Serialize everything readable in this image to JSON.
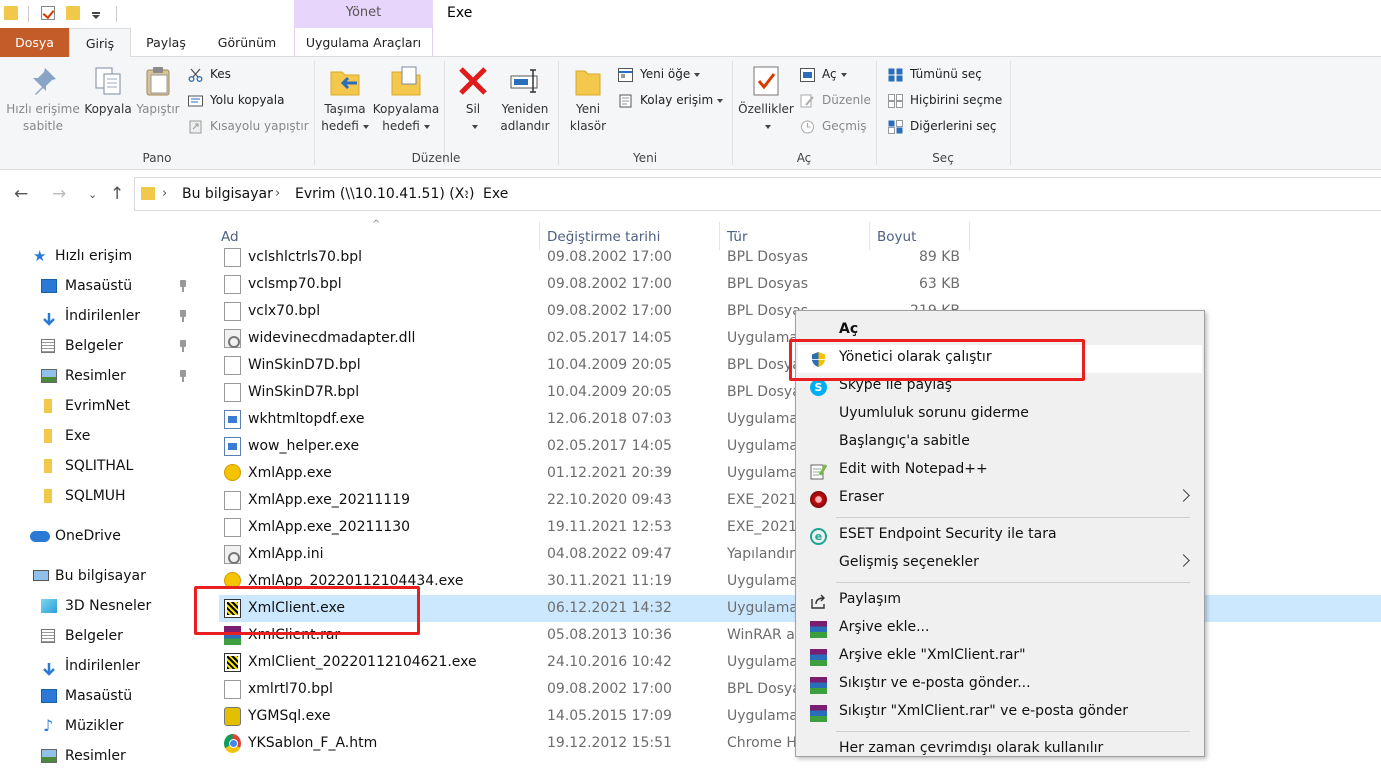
{
  "window": {
    "title": "Exe",
    "contextual_group": "Yönet"
  },
  "ribbon_tabs": [
    "Dosya",
    "Giriş",
    "Paylaş",
    "Görünüm",
    "Uygulama Araçları"
  ],
  "ribbon": {
    "pano": {
      "label": "Pano",
      "pin": [
        "Hızlı erişime",
        "sabitle"
      ],
      "copy": "Kopyala",
      "paste": "Yapıştır",
      "cut": "Kes",
      "copy_path": "Yolu kopyala",
      "paste_shortcut": "Kısayolu yapıştır"
    },
    "duzenle": {
      "label": "Düzenle",
      "move": [
        "Taşıma",
        "hedefi"
      ],
      "copyto": [
        "Kopyalama",
        "hedefi"
      ],
      "delete": "Sil",
      "rename": [
        "Yeniden",
        "adlandır"
      ]
    },
    "yeni": {
      "label": "Yeni",
      "new_folder": [
        "Yeni",
        "klasör"
      ],
      "new_item": "Yeni öğe",
      "easy_access": "Kolay erişim"
    },
    "ac": {
      "label": "Aç",
      "properties": "Özellikler",
      "open": "Aç",
      "edit": "Düzenle",
      "history": "Geçmiş"
    },
    "sec": {
      "label": "Seç",
      "select_all": "Tümünü seç",
      "select_none": "Hiçbirini seçme",
      "invert": "Diğerlerini seç"
    }
  },
  "breadcrumb": [
    "Bu bilgisayar",
    "Evrim (\\\\10.10.41.51) (X:)",
    "Exe"
  ],
  "nav": {
    "quick_access": "Hızlı erişim",
    "quick_items": [
      "Masaüstü",
      "İndirilenler",
      "Belgeler",
      "Resimler",
      "EvrimNet",
      "Exe",
      "SQLITHAL",
      "SQLMUH"
    ],
    "onedrive": "OneDrive",
    "this_pc": "Bu bilgisayar",
    "pc_items": [
      "3D Nesneler",
      "Belgeler",
      "İndirilenler",
      "Masaüstü",
      "Müzikler",
      "Resimler"
    ]
  },
  "columns": {
    "name": "Ad",
    "date": "Değiştirme tarihi",
    "type": "Tür",
    "size": "Boyut"
  },
  "files": [
    {
      "name": "vclshlctrls70.bpl",
      "date": "09.08.2002 17:00",
      "type": "BPL Dosyası",
      "size": "89 KB",
      "icon": "doc"
    },
    {
      "name": "vclsmp70.bpl",
      "date": "09.08.2002 17:00",
      "type": "BPL Dosyası",
      "size": "63 KB",
      "icon": "doc"
    },
    {
      "name": "vclx70.bpl",
      "date": "09.08.2002 17:00",
      "type": "BPL Dosyası",
      "size": "219 KB",
      "icon": "doc"
    },
    {
      "name": "widevinecdmadapter.dll",
      "date": "02.05.2017 14:05",
      "type": "Uygulama",
      "size": "",
      "icon": "ini"
    },
    {
      "name": "WinSkinD7D.bpl",
      "date": "10.04.2009 20:05",
      "type": "BPL Dosyası",
      "size": "",
      "icon": "doc"
    },
    {
      "name": "WinSkinD7R.bpl",
      "date": "10.04.2009 20:05",
      "type": "BPL Dosyası",
      "size": "",
      "icon": "doc"
    },
    {
      "name": "wkhtmltopdf.exe",
      "date": "12.06.2018 07:03",
      "type": "Uygulama",
      "size": "",
      "icon": "exe"
    },
    {
      "name": "wow_helper.exe",
      "date": "02.05.2017 14:05",
      "type": "Uygulama",
      "size": "",
      "icon": "exe"
    },
    {
      "name": "XmlApp.exe",
      "date": "01.12.2021 20:39",
      "type": "Uygulama",
      "size": "",
      "icon": "xml"
    },
    {
      "name": "XmlApp.exe_20211119",
      "date": "22.10.2020 09:43",
      "type": "EXE_20211",
      "size": "",
      "icon": "doc"
    },
    {
      "name": "XmlApp.exe_20211130",
      "date": "19.11.2021 12:53",
      "type": "EXE_20211",
      "size": "",
      "icon": "doc"
    },
    {
      "name": "XmlApp.ini",
      "date": "04.08.2022 09:47",
      "type": "Yapılandırı",
      "size": "",
      "icon": "ini"
    },
    {
      "name": "XmlApp_20220112104434.exe",
      "date": "30.11.2021 11:19",
      "type": "Uygulama",
      "size": "",
      "icon": "xml"
    },
    {
      "name": "XmlClient.exe",
      "date": "06.12.2021 14:32",
      "type": "Uygulama",
      "size": "",
      "icon": "xc",
      "selected": true
    },
    {
      "name": "XmlClient.rar",
      "date": "05.08.2013 10:36",
      "type": "WinRAR ar",
      "size": "",
      "icon": "rar"
    },
    {
      "name": "XmlClient_20220112104621.exe",
      "date": "24.10.2016 10:42",
      "type": "Uygulama",
      "size": "",
      "icon": "xc"
    },
    {
      "name": "xmlrtl70.bpl",
      "date": "09.08.2002 17:00",
      "type": "BPL Dosyası",
      "size": "",
      "icon": "doc"
    },
    {
      "name": "YGMSql.exe",
      "date": "14.05.2015 17:09",
      "type": "Uygulama",
      "size": "",
      "icon": "ygm"
    },
    {
      "name": "YKSablon_F_A.htm",
      "date": "19.12.2012 15:51",
      "type": "Chrome H",
      "size": "",
      "icon": "chrome"
    }
  ],
  "context_menu": {
    "open": "Aç",
    "run_as_admin": "Yönetici olarak çalıştır",
    "skype": "Skype ile paylaş",
    "compat": "Uyumluluk sorunu giderme",
    "pin_start": "Başlangıç'a sabitle",
    "notepad": "Edit with Notepad++",
    "eraser": "Eraser",
    "eset": "ESET Endpoint Security ile tara",
    "advanced": "Gelişmiş seçenekler",
    "share": "Paylaşım",
    "add_archive": "Arşive ekle...",
    "add_rar": "Arşive ekle \"XmlClient.rar\"",
    "compress_email": "Sıkıştır ve e-posta gönder...",
    "compress_rar_email": "Sıkıştır \"XmlClient.rar\" ve e-posta gönder",
    "offline": "Her zaman çevrimdışı olarak kullanılır"
  },
  "colors": {
    "file_tab": "#c45c29",
    "selection": "#cce8ff",
    "highlight_box": "#ea1f1f",
    "contextual_tab": "#e8d5fb"
  }
}
